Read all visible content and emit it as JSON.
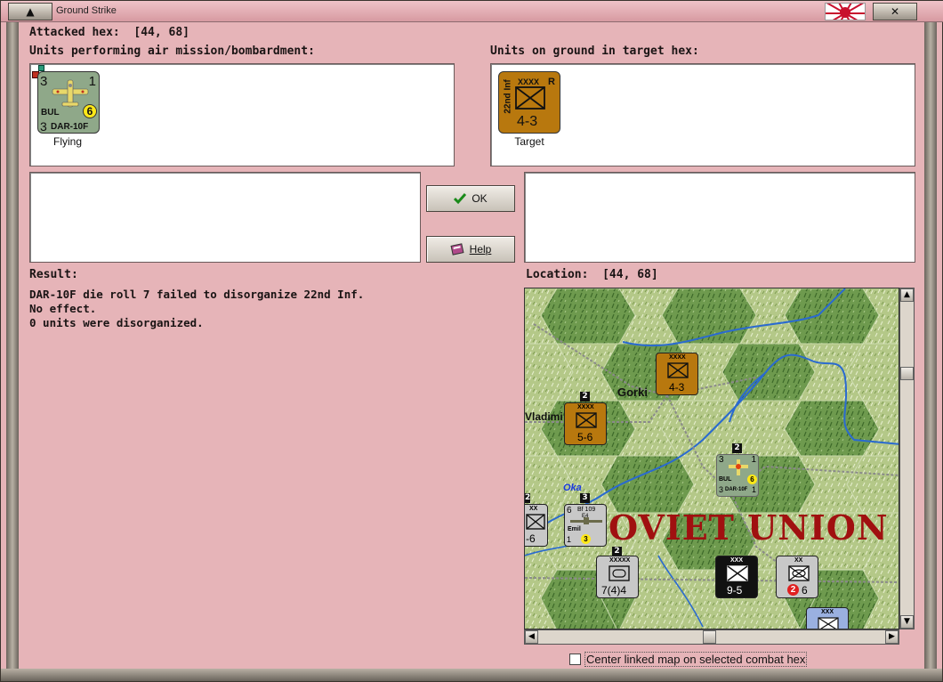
{
  "window": {
    "title": "Ground Strike",
    "minimize_glyph": "▲",
    "close_glyph": "✕"
  },
  "attacked_hex_label": "Attacked hex:  [44, 68]",
  "air_units_heading": "Units performing air mission/bombardment:",
  "ground_units_heading": "Units on ground in target hex:",
  "air_unit": {
    "attack": "3",
    "range_top": "1",
    "nation": "BUL",
    "moves": "6",
    "defense": "3",
    "model": "DAR-10F",
    "status": "Flying"
  },
  "ground_unit": {
    "name": "22nd Inf",
    "size": "XXXX",
    "flag": "R",
    "strength": "4-3",
    "status": "Target"
  },
  "buttons": {
    "ok_label": "OK",
    "help_label": "Help"
  },
  "result": {
    "heading": "Result:",
    "lines": [
      "DAR-10F die roll 7 failed to disorganize 22nd Inf.",
      "No effect.",
      "0 units were disorganized."
    ]
  },
  "location_label": "Location:  [44, 68]",
  "map": {
    "region_label": "OVIET UNION",
    "city_gorki": "Gorki",
    "city_vladimir": "Vladimi",
    "river_oka": "Oka",
    "counters": {
      "gorki_inf": {
        "size": "XXXX",
        "strength": "4-3"
      },
      "vladimir_inf": {
        "size": "XXXX",
        "strength": "5-6",
        "stack": "2"
      },
      "air_bul": {
        "attack": "3",
        "top": "1",
        "nation": "BUL",
        "moves": "6",
        "defense": "3",
        "model": "DAR-10F",
        "range": "1",
        "stack": "2"
      },
      "bf109": {
        "top_left": "6",
        "model": "Bf 109",
        "sub": "E4",
        "name": "Emil",
        "bottom_left": "1",
        "moves": "3",
        "stack": "3"
      },
      "left_partial": {
        "size": "XX",
        "strength": "-6",
        "stack": "2"
      },
      "cav": {
        "size": "XXXXX",
        "strength": "7(4)4",
        "stack": "2"
      },
      "ss": {
        "size": "XXX",
        "strength": "9-5"
      },
      "pz": {
        "size": "XX",
        "attack": "2",
        "defense": "6"
      },
      "blue": {
        "size": "XXX"
      }
    }
  },
  "checkbox_label": "Center linked map on selected combat hex",
  "colors": {
    "background": "#e6b4b8",
    "air_counter": "#8fa889",
    "inf_counter": "#b8780e"
  }
}
